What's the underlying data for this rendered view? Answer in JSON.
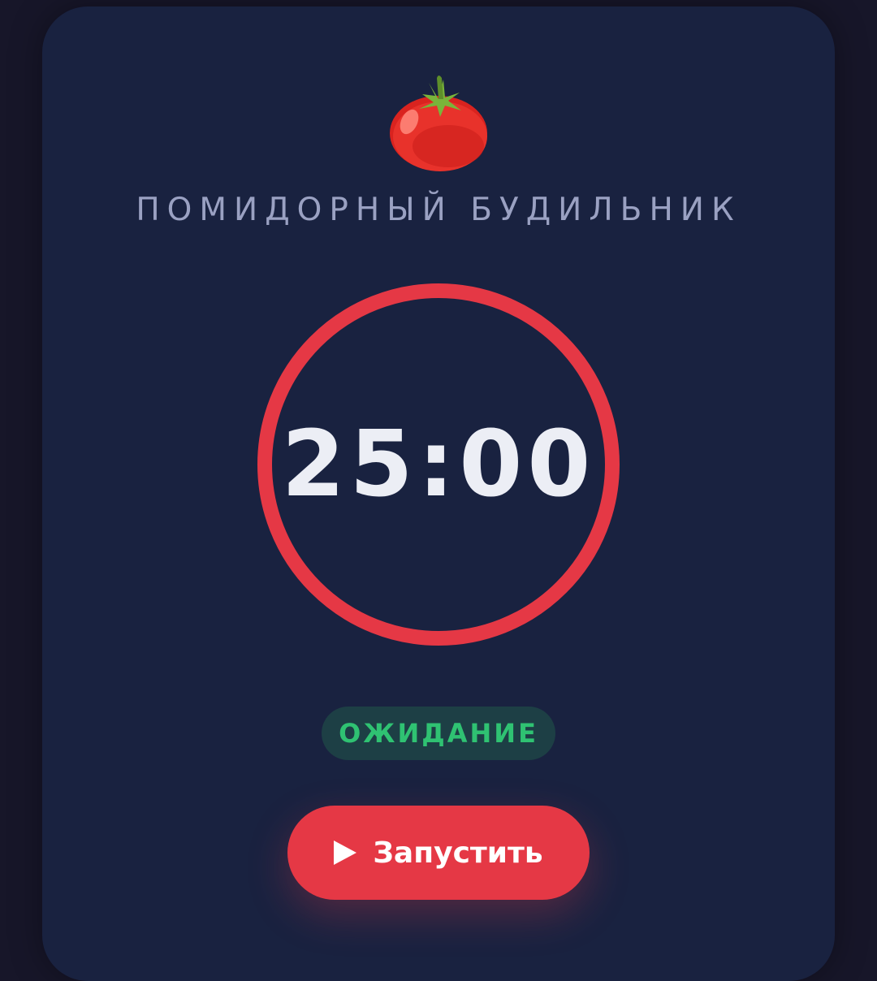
{
  "header": {
    "icon": "tomato-icon",
    "title": "ПОМИДОРНЫЙ БУДИЛЬНИК"
  },
  "timer": {
    "display": "25:00",
    "progress": 1.0
  },
  "status": {
    "label": "ОЖИДАНИЕ"
  },
  "controls": {
    "start_label": "Запустить",
    "start_icon": "play-icon"
  },
  "colors": {
    "background": "#171629",
    "card": "#192240",
    "accent": "#e53845",
    "status_text": "#2fc272",
    "status_bg": "#1d3f45",
    "title_text": "#9aa1c2",
    "timer_text": "#eceef5"
  }
}
